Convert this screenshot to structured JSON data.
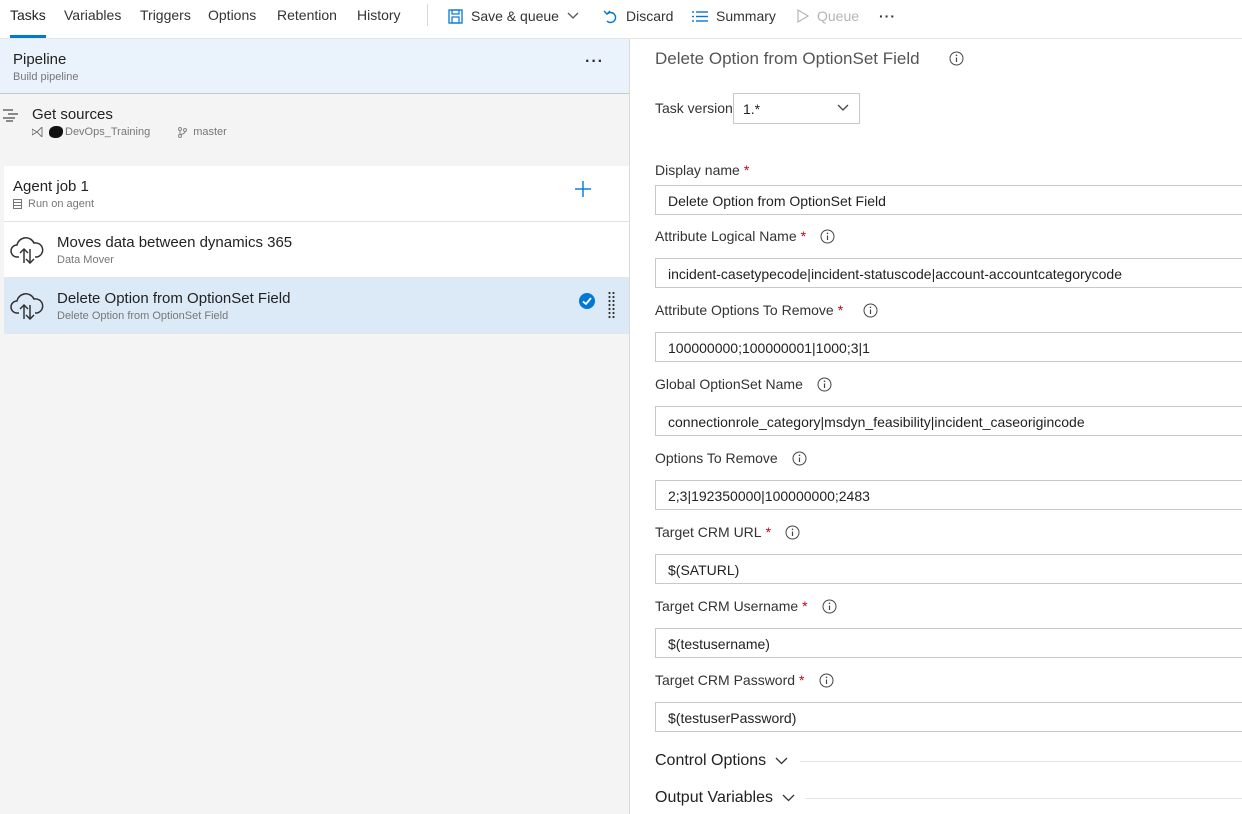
{
  "tabs": [
    {
      "label": "Tasks"
    },
    {
      "label": "Variables"
    },
    {
      "label": "Triggers"
    },
    {
      "label": "Options"
    },
    {
      "label": "Retention"
    },
    {
      "label": "History"
    }
  ],
  "toolbar": {
    "save_queue_label": "Save & queue",
    "discard_label": "Discard",
    "summary_label": "Summary",
    "queue_label": "Queue",
    "more_label": "···"
  },
  "pipeline": {
    "title": "Pipeline",
    "subtitle": "Build pipeline",
    "more_label": "···"
  },
  "get_sources": {
    "title": "Get sources",
    "repo": "DevOps_Training",
    "branch": "master"
  },
  "agent_job": {
    "title": "Agent job 1",
    "subtitle": "Run on agent"
  },
  "tasks": [
    {
      "title": "Moves data between dynamics 365",
      "subtitle": "Data Mover",
      "selected": false
    },
    {
      "title": "Delete Option from OptionSet Field",
      "subtitle": "Delete Option from OptionSet Field",
      "selected": true
    }
  ],
  "detail": {
    "title": "Delete Option from OptionSet Field",
    "task_version_label": "Task version",
    "task_version_value": "1.*",
    "fields": [
      {
        "label": "Display name",
        "required": "*",
        "value": "Delete Option from OptionSet Field"
      },
      {
        "label": "Attribute Logical Name",
        "required": "*",
        "value": "incident-casetypecode|incident-statuscode|account-accountcategorycode"
      },
      {
        "label": "Attribute Options To Remove",
        "required": "*",
        "value": "100000000;100000001|1000;3|1"
      },
      {
        "label": "Global OptionSet Name",
        "required": "",
        "value": "connectionrole_category|msdyn_feasibility|incident_caseorigincode"
      },
      {
        "label": "Options To Remove",
        "required": "",
        "value": "2;3|192350000|100000000;2483"
      },
      {
        "label": "Target CRM URL",
        "required": "*",
        "value": "$(SATURL)"
      },
      {
        "label": "Target CRM Username",
        "required": "*",
        "value": "$(testusername)"
      },
      {
        "label": "Target CRM Password",
        "required": "*",
        "value": "$(testuserPassword)"
      }
    ],
    "sections": [
      {
        "label": "Control Options"
      },
      {
        "label": "Output Variables"
      }
    ]
  },
  "colors": {
    "accent": "#0078d4",
    "selected_row": "#dce9f7",
    "required": "#c4001a"
  }
}
